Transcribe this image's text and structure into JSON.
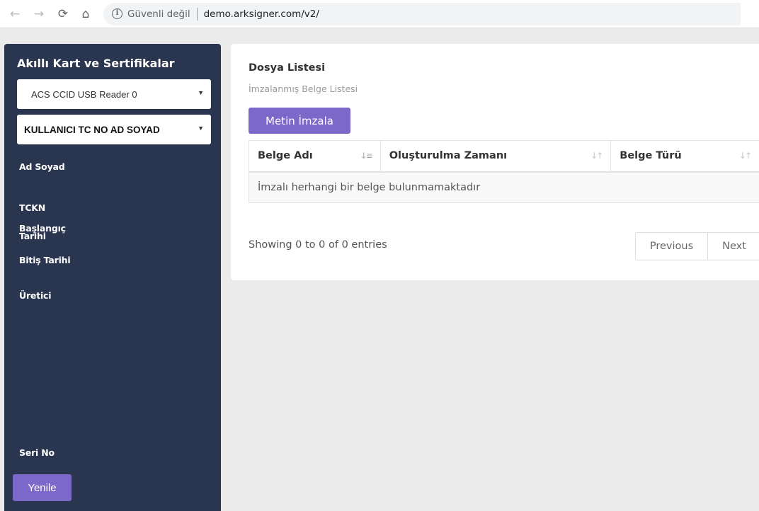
{
  "browser": {
    "back_icon": "arrow-left",
    "forward_icon": "arrow-right",
    "reload_icon": "reload",
    "home_icon": "home",
    "security_text": "Güvenli değil",
    "url": "demo.arksigner.com/v2/"
  },
  "sidebar": {
    "title": "Akıllı Kart ve Sertifikalar",
    "reader_select": "ACS CCID USB Reader 0",
    "user_select": "KULLANICI TC NO AD SOYAD",
    "fields": {
      "name": "Ad Soyad",
      "tckn": "TCKN",
      "start_date_1": "Başlangıç",
      "start_date_2": "Tarihi",
      "end_date": "Bitiş Tarihi",
      "producer": "Üretici",
      "serial": "Seri No"
    },
    "refresh_label": "Yenile",
    "colors": {
      "background": "#2a3550",
      "accent": "#7c68c8"
    }
  },
  "main": {
    "title": "Dosya Listesi",
    "subtitle": "İmzalanmış Belge Listesi",
    "sign_button": "Metin İmzala",
    "table": {
      "columns": [
        "Belge Adı",
        "Oluşturulma Zamanı",
        "Belge Türü"
      ],
      "empty_message": "İmzalı herhangi bir belge bulunmamaktadır"
    },
    "info": "Showing 0 to 0 of 0 entries",
    "pagination": {
      "previous": "Previous",
      "next": "Next"
    }
  }
}
